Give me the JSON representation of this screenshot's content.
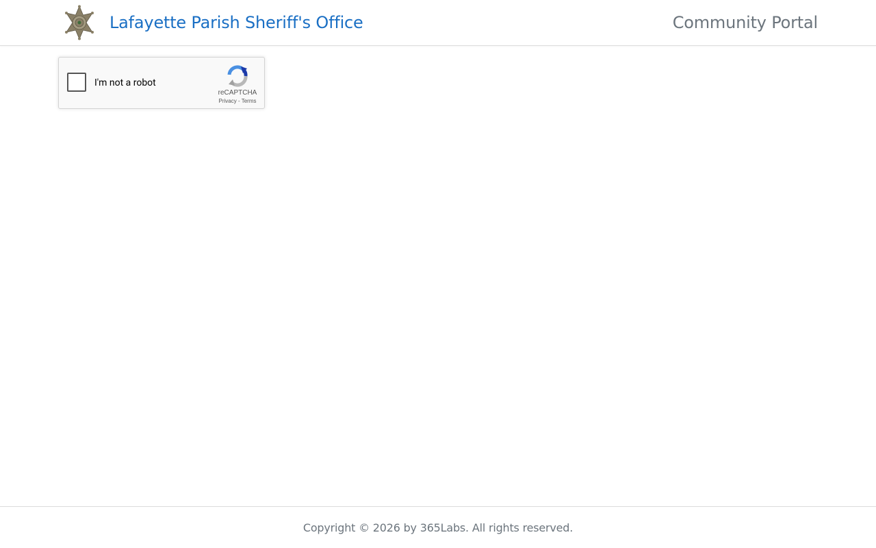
{
  "header": {
    "brand_title": "Lafayette Parish Sheriff's Office",
    "portal_title": "Community Portal",
    "logo_icon": "sheriff-star-badge"
  },
  "recaptcha": {
    "label": "I'm not a robot",
    "brand": "reCAPTCHA",
    "privacy_link": "Privacy",
    "separator": " - ",
    "terms_link": "Terms",
    "checked": false
  },
  "footer": {
    "copyright": "Copyright © 2026 by 365Labs. All rights reserved."
  },
  "colors": {
    "brand_blue": "#1a6fc4",
    "muted_gray": "#6c757d",
    "badge_gold": "#8a8067"
  }
}
